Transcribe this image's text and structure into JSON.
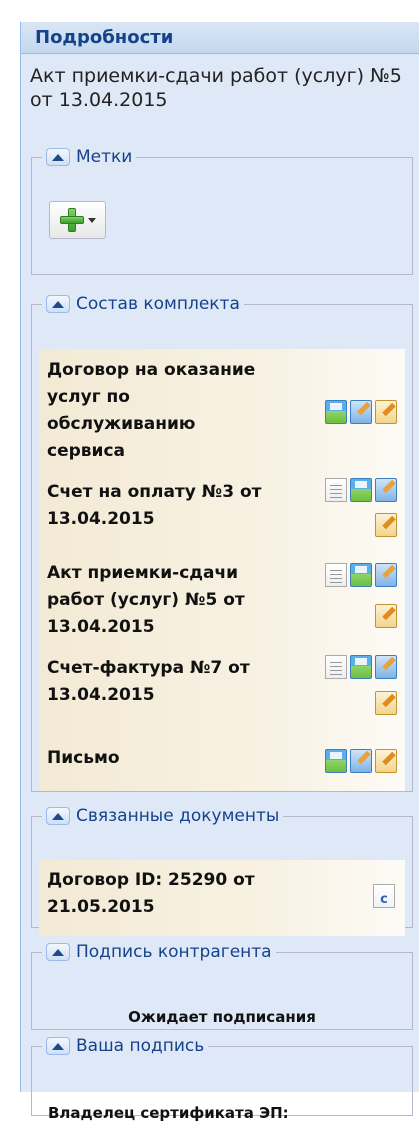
{
  "panel": {
    "title": "Подробности"
  },
  "document": {
    "title": "Акт приемки-сдачи работ (услуг) №5 от 13.04.2015"
  },
  "labels": {
    "legend": "Метки"
  },
  "kit": {
    "legend": "Состав комплекта",
    "items": [
      {
        "title": "Договор на оказание услуг по обслуживанию сервиса",
        "icons": [
          "save-icon",
          "edit-icon",
          "sign-icon"
        ]
      },
      {
        "title": "Счет на оплату №3 от 13.04.2015",
        "icons": [
          "document-icon",
          "save-icon",
          "edit-icon",
          "sign-icon"
        ]
      },
      {
        "title": "Акт приемки-сдачи работ (услуг) №5 от 13.04.2015",
        "icons": [
          "document-icon",
          "save-icon",
          "edit-icon",
          "sign-icon"
        ]
      },
      {
        "title": "Счет-фактура №7 от 13.04.2015",
        "icons": [
          "document-icon",
          "save-icon",
          "edit-icon",
          "sign-icon"
        ]
      },
      {
        "title": "Письмо",
        "icons": [
          "save-icon",
          "edit-icon",
          "sign-icon"
        ]
      }
    ]
  },
  "related": {
    "legend": "Связанные документы",
    "items": [
      {
        "title": "Договор ID: 25290 от 21.05.2015",
        "icon": "c",
        "icon_name": "contract-icon"
      }
    ]
  },
  "counterparty": {
    "legend": "Подпись контрагента",
    "status": "Ожидает подписания"
  },
  "my_signature": {
    "legend": "Ваша подпись",
    "owner_label": "Владелец сертификата ЭП:"
  },
  "colors": {
    "header_text": "#15428b",
    "panel_bg": "#dfe8f6",
    "row_bg": "#f3ead5"
  }
}
